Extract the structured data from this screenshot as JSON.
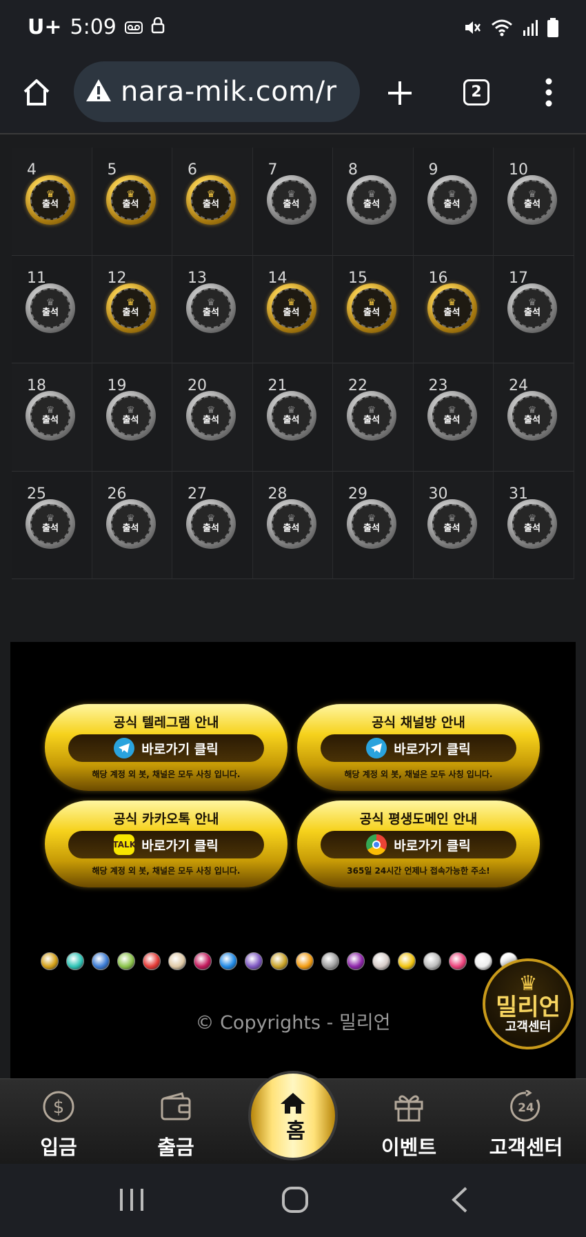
{
  "status": {
    "carrier": "U+",
    "time": "5:09"
  },
  "browser": {
    "url": "nara-mik.com/r",
    "tab_count": "2"
  },
  "calendar": {
    "days": [
      {
        "n": "4",
        "checked": true
      },
      {
        "n": "5",
        "checked": true
      },
      {
        "n": "6",
        "checked": true
      },
      {
        "n": "7",
        "checked": false
      },
      {
        "n": "8",
        "checked": false
      },
      {
        "n": "9",
        "checked": false
      },
      {
        "n": "10",
        "checked": false
      },
      {
        "n": "11",
        "checked": false
      },
      {
        "n": "12",
        "checked": true
      },
      {
        "n": "13",
        "checked": false
      },
      {
        "n": "14",
        "checked": true
      },
      {
        "n": "15",
        "checked": true
      },
      {
        "n": "16",
        "checked": true
      },
      {
        "n": "17",
        "checked": false
      },
      {
        "n": "18",
        "checked": false
      },
      {
        "n": "19",
        "checked": false
      },
      {
        "n": "20",
        "checked": false
      },
      {
        "n": "21",
        "checked": false
      },
      {
        "n": "22",
        "checked": false
      },
      {
        "n": "23",
        "checked": false
      },
      {
        "n": "24",
        "checked": false
      },
      {
        "n": "25",
        "checked": false
      },
      {
        "n": "26",
        "checked": false
      },
      {
        "n": "27",
        "checked": false
      },
      {
        "n": "28",
        "checked": false
      },
      {
        "n": "29",
        "checked": false
      },
      {
        "n": "30",
        "checked": false
      },
      {
        "n": "31",
        "checked": false
      }
    ],
    "badge_label": "출석"
  },
  "promos": [
    {
      "title": "공식 텔레그램 안내",
      "button": "바로가기 클릭",
      "note": "해당 계정 외 봇, 채널은 모두 사칭 입니다.",
      "icon": "telegram-icon"
    },
    {
      "title": "공식 채널방 안내",
      "button": "바로가기 클릭",
      "note": "해당 계정 외 봇, 채널은 모두 사칭 입니다.",
      "icon": "telegram-icon"
    },
    {
      "title": "공식 카카오톡 안내",
      "button": "바로가기 클릭",
      "note": "해당 계정 외 봇, 채널은 모두 사칭 입니다.",
      "icon": "kakaotalk-icon",
      "icon_text": "TALK"
    },
    {
      "title": "공식 평생도메인 안내",
      "button": "바로가기 클릭",
      "note": "365일 24시간 언제나 접속가능한 주소!",
      "icon": "chrome-icon"
    }
  ],
  "providers_count_visible": 19,
  "copyright": "© Copyrights - 밀리언",
  "customer_center_float": {
    "title": "밀리언",
    "subtitle": "고객센터"
  },
  "bottom_nav": {
    "deposit": "입금",
    "withdraw": "출금",
    "home": "홈",
    "event": "이벤트",
    "support": "고객센터"
  },
  "colors": {
    "gold": "#f2c94c",
    "background": "#1b1c1e",
    "footer": "#000000"
  }
}
